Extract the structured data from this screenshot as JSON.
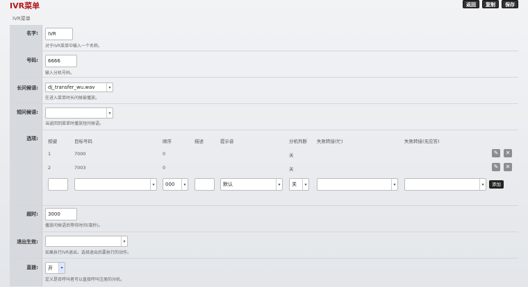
{
  "header": {
    "title": "IVR菜单",
    "subtitle": "IVR菜单",
    "buttons": {
      "back": "返回",
      "copy": "复制",
      "save": "保存"
    }
  },
  "fields": {
    "name": {
      "label": "名字:",
      "value": "IVR",
      "hint": "对于IVR菜单中输入一个名称。"
    },
    "number": {
      "label": "号码:",
      "value": "6666",
      "hint": "输入分机号码。"
    },
    "long_greeting": {
      "label": "长问候语:",
      "value": "dj_transfer_wu.wav",
      "hint": "在进入菜单时长问候被播放。"
    },
    "short_greeting": {
      "label": "短问候语:",
      "value": "",
      "hint": "当返回到菜单时播放短问候语。"
    },
    "timeout": {
      "label": "超时:",
      "value": "3000",
      "hint": "播放问候语后等待时间(毫秒)。"
    },
    "exit_action": {
      "label": "退出生效:",
      "value": "",
      "hint": "如果执行IVR退出，选择退出后要执行的动作。"
    },
    "direct_dial": {
      "label": "直拨:",
      "value": "开",
      "hint": "定义是否呼叫者可以直接呼叫注册的分机。"
    }
  },
  "options": {
    "label": "选项:",
    "headers": [
      "按键",
      "目标号码",
      "顺序",
      "描述",
      "提示音",
      "分机判断",
      "失败转接(忙)",
      "失败转接(无应答)"
    ],
    "rows": [
      {
        "key": "1",
        "target": "7000",
        "order": "0",
        "desc": "",
        "prompt": "",
        "check": "关"
      },
      {
        "key": "2",
        "target": "7003",
        "order": "0",
        "desc": "",
        "prompt": "",
        "check": "关"
      }
    ],
    "new_row": {
      "order": "000",
      "prompt": "默认",
      "check": "关",
      "add_label": "添加"
    }
  },
  "icons": {
    "edit": "pencil-icon",
    "delete": "close-icon",
    "dropdown": "chevron-down-icon"
  }
}
